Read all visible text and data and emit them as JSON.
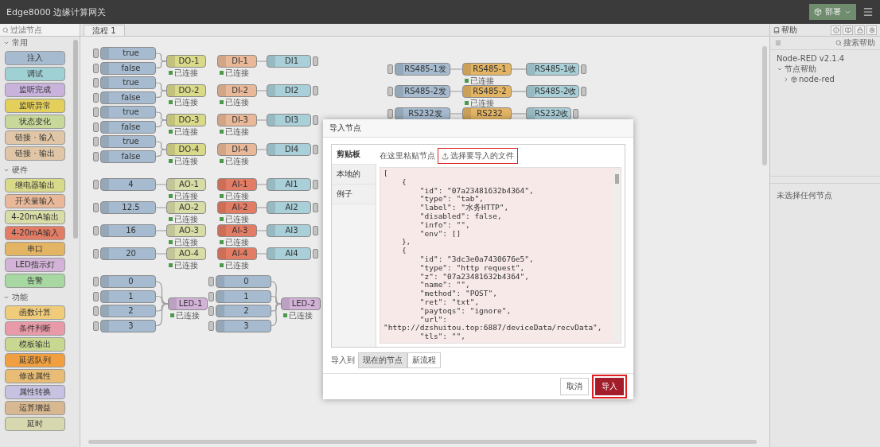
{
  "header": {
    "title": "Edge8000 边缘计算网关",
    "deploy": "部署"
  },
  "palette": {
    "filter_placeholder": "过滤节点",
    "categories": [
      {
        "name": "常用",
        "expanded": true,
        "nodes": [
          {
            "label": "注入",
            "color": "#a6bbcf"
          },
          {
            "label": "调试",
            "color": "#9fd0d4"
          },
          {
            "label": "监听完成",
            "color": "#c9b3dc"
          },
          {
            "label": "监听异常",
            "color": "#e3cf5a"
          },
          {
            "label": "状态变化",
            "color": "#c8d89a"
          },
          {
            "label": "链接 · 输入",
            "color": "#e0c6a6"
          },
          {
            "label": "链接 · 输出",
            "color": "#e0c6a6"
          }
        ]
      },
      {
        "name": "硬件",
        "expanded": true,
        "nodes": [
          {
            "label": "继电器输出",
            "color": "#d9d98a"
          },
          {
            "label": "开关量输入",
            "color": "#e8b898"
          },
          {
            "label": "4-20mA输出",
            "color": "#d8dca6"
          },
          {
            "label": "4-20mA输入",
            "color": "#e27c64"
          },
          {
            "label": "串口",
            "color": "#e2b464"
          },
          {
            "label": "LED指示灯",
            "color": "#d3b4d8"
          },
          {
            "label": "告警",
            "color": "#a8d8a2"
          }
        ]
      },
      {
        "name": "功能",
        "expanded": true,
        "nodes": [
          {
            "label": "函数计算",
            "color": "#f0cc7a"
          },
          {
            "label": "条件判断",
            "color": "#e89aa8"
          },
          {
            "label": "模板输出",
            "color": "#c8d890"
          },
          {
            "label": "延迟队列",
            "color": "#f0a040"
          },
          {
            "label": "修改属性",
            "color": "#e8bc74"
          },
          {
            "label": "属性转换",
            "color": "#c8c2e2"
          },
          {
            "label": "运算增益",
            "color": "#d8b890"
          },
          {
            "label": "延时",
            "color": "#d8d8b0"
          }
        ]
      }
    ]
  },
  "workspace": {
    "tabs": [
      {
        "label": "流程 1",
        "selected": true
      }
    ],
    "nodes": [
      {
        "kind": "inject",
        "label": "true"
      },
      {
        "kind": "inject",
        "label": "false"
      },
      {
        "kind": "inject",
        "label": "true"
      },
      {
        "kind": "inject",
        "label": "false"
      },
      {
        "kind": "inject",
        "label": "true"
      },
      {
        "kind": "inject",
        "label": "false"
      },
      {
        "kind": "inject",
        "label": "true"
      },
      {
        "kind": "inject",
        "label": "false"
      },
      {
        "kind": "do",
        "label": "DO-1",
        "status": "已连接"
      },
      {
        "kind": "do",
        "label": "DO-2",
        "status": "已连接"
      },
      {
        "kind": "do",
        "label": "DO-3",
        "status": "已连接"
      },
      {
        "kind": "do",
        "label": "DO-4",
        "status": "已连接"
      },
      {
        "kind": "di",
        "label": "DI-1",
        "status": "已连接"
      },
      {
        "kind": "di",
        "label": "DI-2",
        "status": "已连接"
      },
      {
        "kind": "di",
        "label": "DI-3",
        "status": "已连接"
      },
      {
        "kind": "di",
        "label": "DI-4",
        "status": "已连接"
      },
      {
        "kind": "debug",
        "label": "DI1"
      },
      {
        "kind": "debug",
        "label": "DI2"
      },
      {
        "kind": "debug",
        "label": "DI3"
      },
      {
        "kind": "debug",
        "label": "DI4"
      },
      {
        "kind": "inject",
        "label": "4"
      },
      {
        "kind": "inject",
        "label": "12.5"
      },
      {
        "kind": "inject",
        "label": "16"
      },
      {
        "kind": "inject",
        "label": "20"
      },
      {
        "kind": "ao",
        "label": "AO-1",
        "status": "已连接"
      },
      {
        "kind": "ao",
        "label": "AO-2",
        "status": "已连接"
      },
      {
        "kind": "ao",
        "label": "AO-3",
        "status": "已连接"
      },
      {
        "kind": "ao",
        "label": "AO-4",
        "status": "已连接"
      },
      {
        "kind": "ai",
        "label": "AI-1",
        "status": "已连接"
      },
      {
        "kind": "ai",
        "label": "AI-2",
        "status": "已连接"
      },
      {
        "kind": "ai",
        "label": "AI-3",
        "status": "已连接"
      },
      {
        "kind": "ai",
        "label": "AI-4",
        "status": "已连接"
      },
      {
        "kind": "debug",
        "label": "AI1"
      },
      {
        "kind": "debug",
        "label": "AI2"
      },
      {
        "kind": "debug",
        "label": "AI3"
      },
      {
        "kind": "debug",
        "label": "AI4"
      },
      {
        "kind": "inject",
        "label": "0"
      },
      {
        "kind": "inject",
        "label": "1"
      },
      {
        "kind": "inject",
        "label": "2"
      },
      {
        "kind": "inject",
        "label": "3"
      },
      {
        "kind": "led",
        "label": "LED-1",
        "status": "已连接"
      },
      {
        "kind": "inject",
        "label": "0"
      },
      {
        "kind": "inject",
        "label": "1"
      },
      {
        "kind": "inject",
        "label": "2"
      },
      {
        "kind": "inject",
        "label": "3"
      },
      {
        "kind": "led",
        "label": "LED-2",
        "status": "已连接"
      },
      {
        "kind": "inject",
        "label": "RS485-1发"
      },
      {
        "kind": "serial",
        "label": "RS485-1",
        "status": "已连接"
      },
      {
        "kind": "debug",
        "label": "RS485-1收"
      },
      {
        "kind": "inject",
        "label": "RS485-2发"
      },
      {
        "kind": "serial",
        "label": "RS485-2",
        "status": "已连接"
      },
      {
        "kind": "debug",
        "label": "RS485-2收"
      },
      {
        "kind": "inject",
        "label": "RS232发"
      },
      {
        "kind": "serial",
        "label": "RS232"
      },
      {
        "kind": "debug",
        "label": "RS232收"
      }
    ]
  },
  "sidebar": {
    "tab": "帮助",
    "search_placeholder": "搜索帮助",
    "tree": [
      {
        "label": "Node-RED v2.1.4"
      },
      {
        "label": "节点帮助",
        "expanded": true,
        "children": [
          {
            "label": "node-red",
            "expanded": false
          }
        ]
      }
    ],
    "footer": "未选择任何节点"
  },
  "dialog": {
    "title": "导入节点",
    "tabs": [
      {
        "label": "剪贴板",
        "selected": true
      },
      {
        "label": "本地的",
        "selected": false
      },
      {
        "label": "例子",
        "selected": false
      }
    ],
    "paste_hint": "在这里粘贴节点",
    "file_button": "选择要导入的文件",
    "clipboard_text": "[\n    {\n        \"id\": \"07a23481632b4364\",\n        \"type\": \"tab\",\n        \"label\": \"水务HTTP\",\n        \"disabled\": false,\n        \"info\": \"\",\n        \"env\": []\n    },\n    {\n        \"id\": \"3dc3e0a7430676e5\",\n        \"type\": \"http request\",\n        \"z\": \"07a23481632b4364\",\n        \"name\": \"\",\n        \"method\": \"POST\",\n        \"ret\": \"txt\",\n        \"paytoqs\": \"ignore\",\n        \"url\":\n\"http://dzshuitou.top:6887/deviceData/recvData\",\n        \"tls\": \"\",",
    "import_to_label": "导入到",
    "import_targets": [
      {
        "label": "现在的节点",
        "selected": true
      },
      {
        "label": "新流程",
        "selected": false
      }
    ],
    "cancel": "取消",
    "confirm": "导入"
  }
}
